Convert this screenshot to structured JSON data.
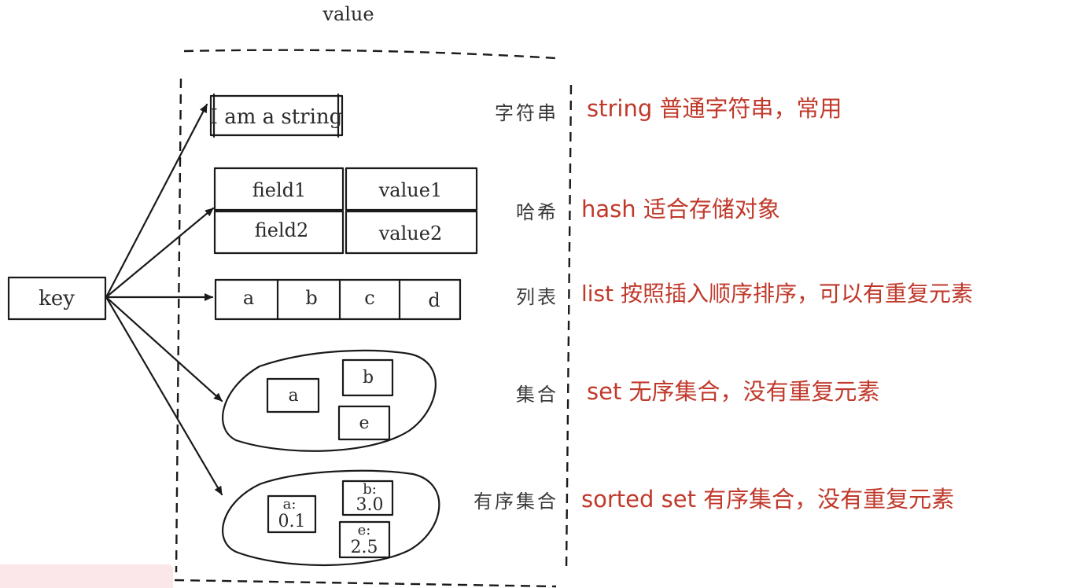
{
  "header": {
    "value_label": "value"
  },
  "key_label": "key",
  "types": {
    "string": {
      "cn": "字符串",
      "desc": "string 普通字符串，常用",
      "content": "I am a string"
    },
    "hash": {
      "cn": "哈希",
      "desc": "hash 适合存储对象",
      "rows": [
        {
          "field": "field1",
          "value": "value1"
        },
        {
          "field": "field2",
          "value": "value2"
        }
      ]
    },
    "list": {
      "cn": "列表",
      "desc": "list 按照插入顺序排序，可以有重复元素",
      "items": [
        "a",
        "b",
        "c",
        "d"
      ]
    },
    "set": {
      "cn": "集合",
      "desc": "set 无序集合，没有重复元素",
      "items": [
        "a",
        "b",
        "e"
      ]
    },
    "zset": {
      "cn": "有序集合",
      "desc": "sorted set 有序集合，没有重复元素",
      "items": [
        {
          "member": "a:",
          "score": "0.1"
        },
        {
          "member": "b:",
          "score": "3.0"
        },
        {
          "member": "e:",
          "score": "2.5"
        }
      ]
    }
  }
}
